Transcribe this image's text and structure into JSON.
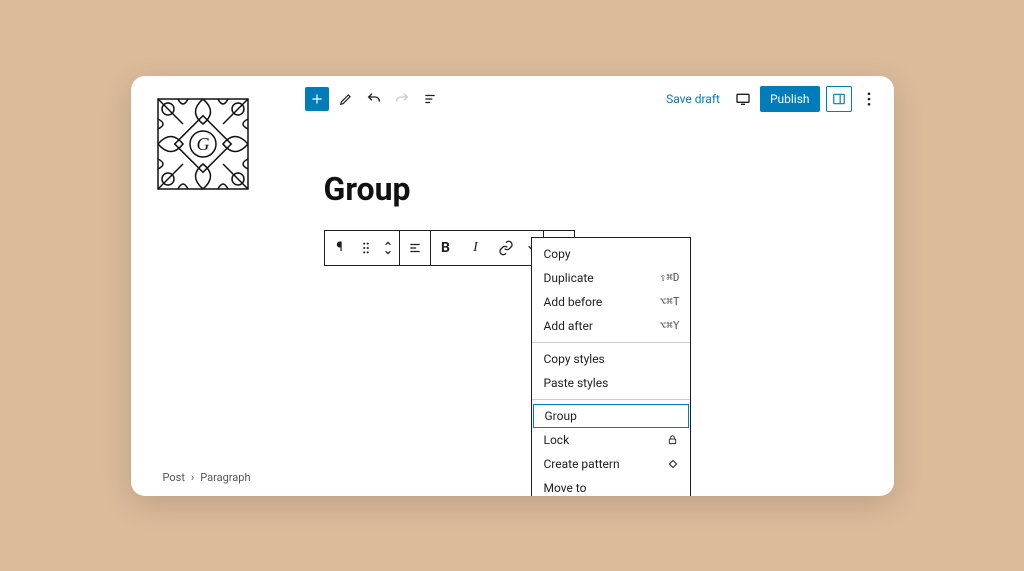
{
  "title": "Group",
  "topbar": {
    "save_draft": "Save draft",
    "publish": "Publish"
  },
  "breadcrumb": {
    "root": "Post",
    "leaf": "Paragraph"
  },
  "menu": {
    "section1": [
      {
        "label": "Copy",
        "shortcut": ""
      },
      {
        "label": "Duplicate",
        "shortcut": "⇧⌘D"
      },
      {
        "label": "Add before",
        "shortcut": "⌥⌘T"
      },
      {
        "label": "Add after",
        "shortcut": "⌥⌘Y"
      }
    ],
    "section2": [
      {
        "label": "Copy styles",
        "shortcut": ""
      },
      {
        "label": "Paste styles",
        "shortcut": ""
      }
    ],
    "section3": [
      {
        "label": "Group",
        "shortcut": "",
        "highlight": true
      },
      {
        "label": "Lock",
        "icon": "lock"
      },
      {
        "label": "Create pattern",
        "icon": "diamond"
      },
      {
        "label": "Move to",
        "shortcut": ""
      }
    ]
  }
}
